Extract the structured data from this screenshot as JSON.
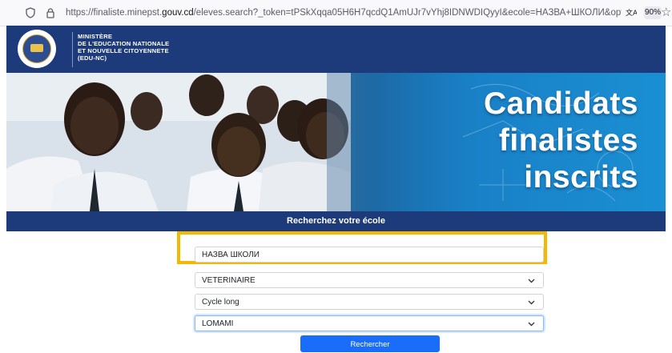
{
  "browser": {
    "url_prefix": "https://finaliste.minepst.",
    "url_domain": "gouv.cd",
    "url_suffix": "/eleves.search?_token=tPSkXqqa05H6H7qcdQ1AmUJr7vYhj8IDNWDIQyyI&ecole=НАЗВА+ШКОЛИ&options=SCI",
    "zoom": "90%"
  },
  "header": {
    "line1": "MINISTÈRE",
    "line2": "DE L'EDUCATION NATIONALE",
    "line3": "ET NOUVELLE CITOYENNETE",
    "line4": "(EDU-NC)"
  },
  "hero": {
    "line1": "Candidats",
    "line2": "finalistes",
    "line3": "inscrits"
  },
  "search": {
    "title": "Recherchez votre école",
    "school_value": "НАЗВА ШКОЛИ",
    "option_value": "VETERINAIRE",
    "cycle_value": "Cycle long",
    "province_value": "LOMAMI",
    "submit_label": "Rechercher"
  },
  "colors": {
    "header_bg": "#1d3a7a",
    "highlight": "#f5b800",
    "button": "#1a6dfa"
  }
}
